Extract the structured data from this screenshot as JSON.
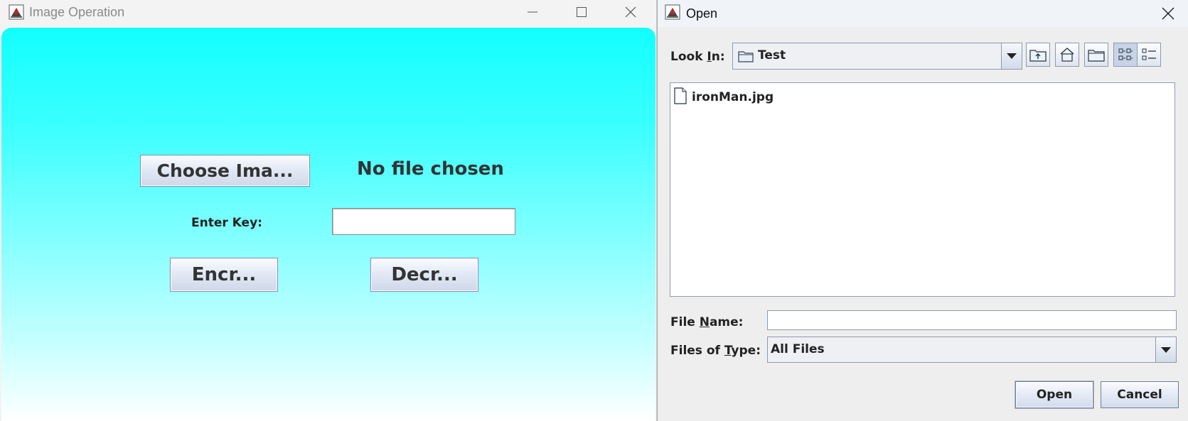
{
  "image_operation_window": {
    "title": "Image Operation",
    "choose_image_button": "Choose Ima...",
    "file_status": "No file chosen",
    "enter_key_label": "Enter Key:",
    "key_value": "",
    "encrypt_button": "Encr...",
    "decrypt_button": "Decr..."
  },
  "open_dialog": {
    "title": "Open",
    "look_in_label_pre": "Look ",
    "look_in_label_mnemonic": "I",
    "look_in_label_post": "n:",
    "look_in_value": "Test",
    "toolbar_icons": [
      "up-one-level-icon",
      "home-icon",
      "new-folder-icon",
      "list-view-icon",
      "details-view-icon"
    ],
    "files": [
      {
        "name": "ironMan.jpg",
        "icon": "file-icon"
      }
    ],
    "file_name_label_pre": "File ",
    "file_name_label_mnemonic": "N",
    "file_name_label_post": "ame:",
    "file_name_value": "",
    "files_of_type_label_pre": "Files of ",
    "files_of_type_label_mnemonic": "T",
    "files_of_type_label_post": "ype:",
    "files_of_type_value": "All Files",
    "open_button": "Open",
    "cancel_button": "Cancel"
  }
}
